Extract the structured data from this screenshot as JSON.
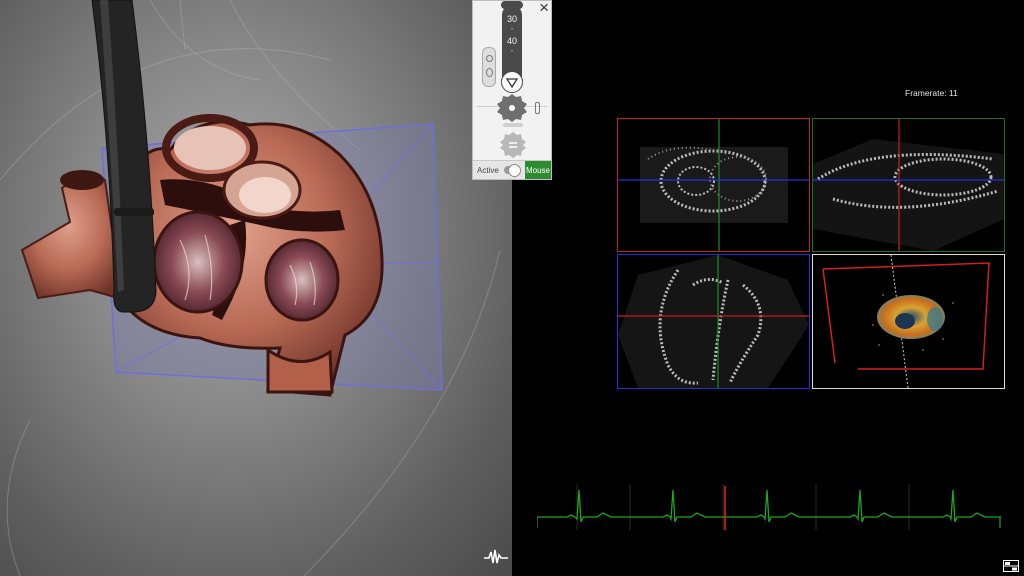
{
  "control_panel": {
    "close_glyph": "×",
    "scale_marks": [
      "30",
      "-",
      "40",
      "-"
    ],
    "toggle": {
      "left_label": "Active",
      "right_label": "Mouse",
      "state": "mouse"
    }
  },
  "ultrasound": {
    "framerate_label": "Framerate: 11",
    "crosshair_colors": {
      "red": "#d01f1f",
      "green": "#1f8f1f",
      "blue": "#2232d8"
    }
  },
  "ecg": {
    "color": "#1ea61e",
    "marker_color": "#e02020"
  },
  "icons": {
    "left_corner": "waveform-icon",
    "right_corner": "layout-toggle-icon"
  }
}
